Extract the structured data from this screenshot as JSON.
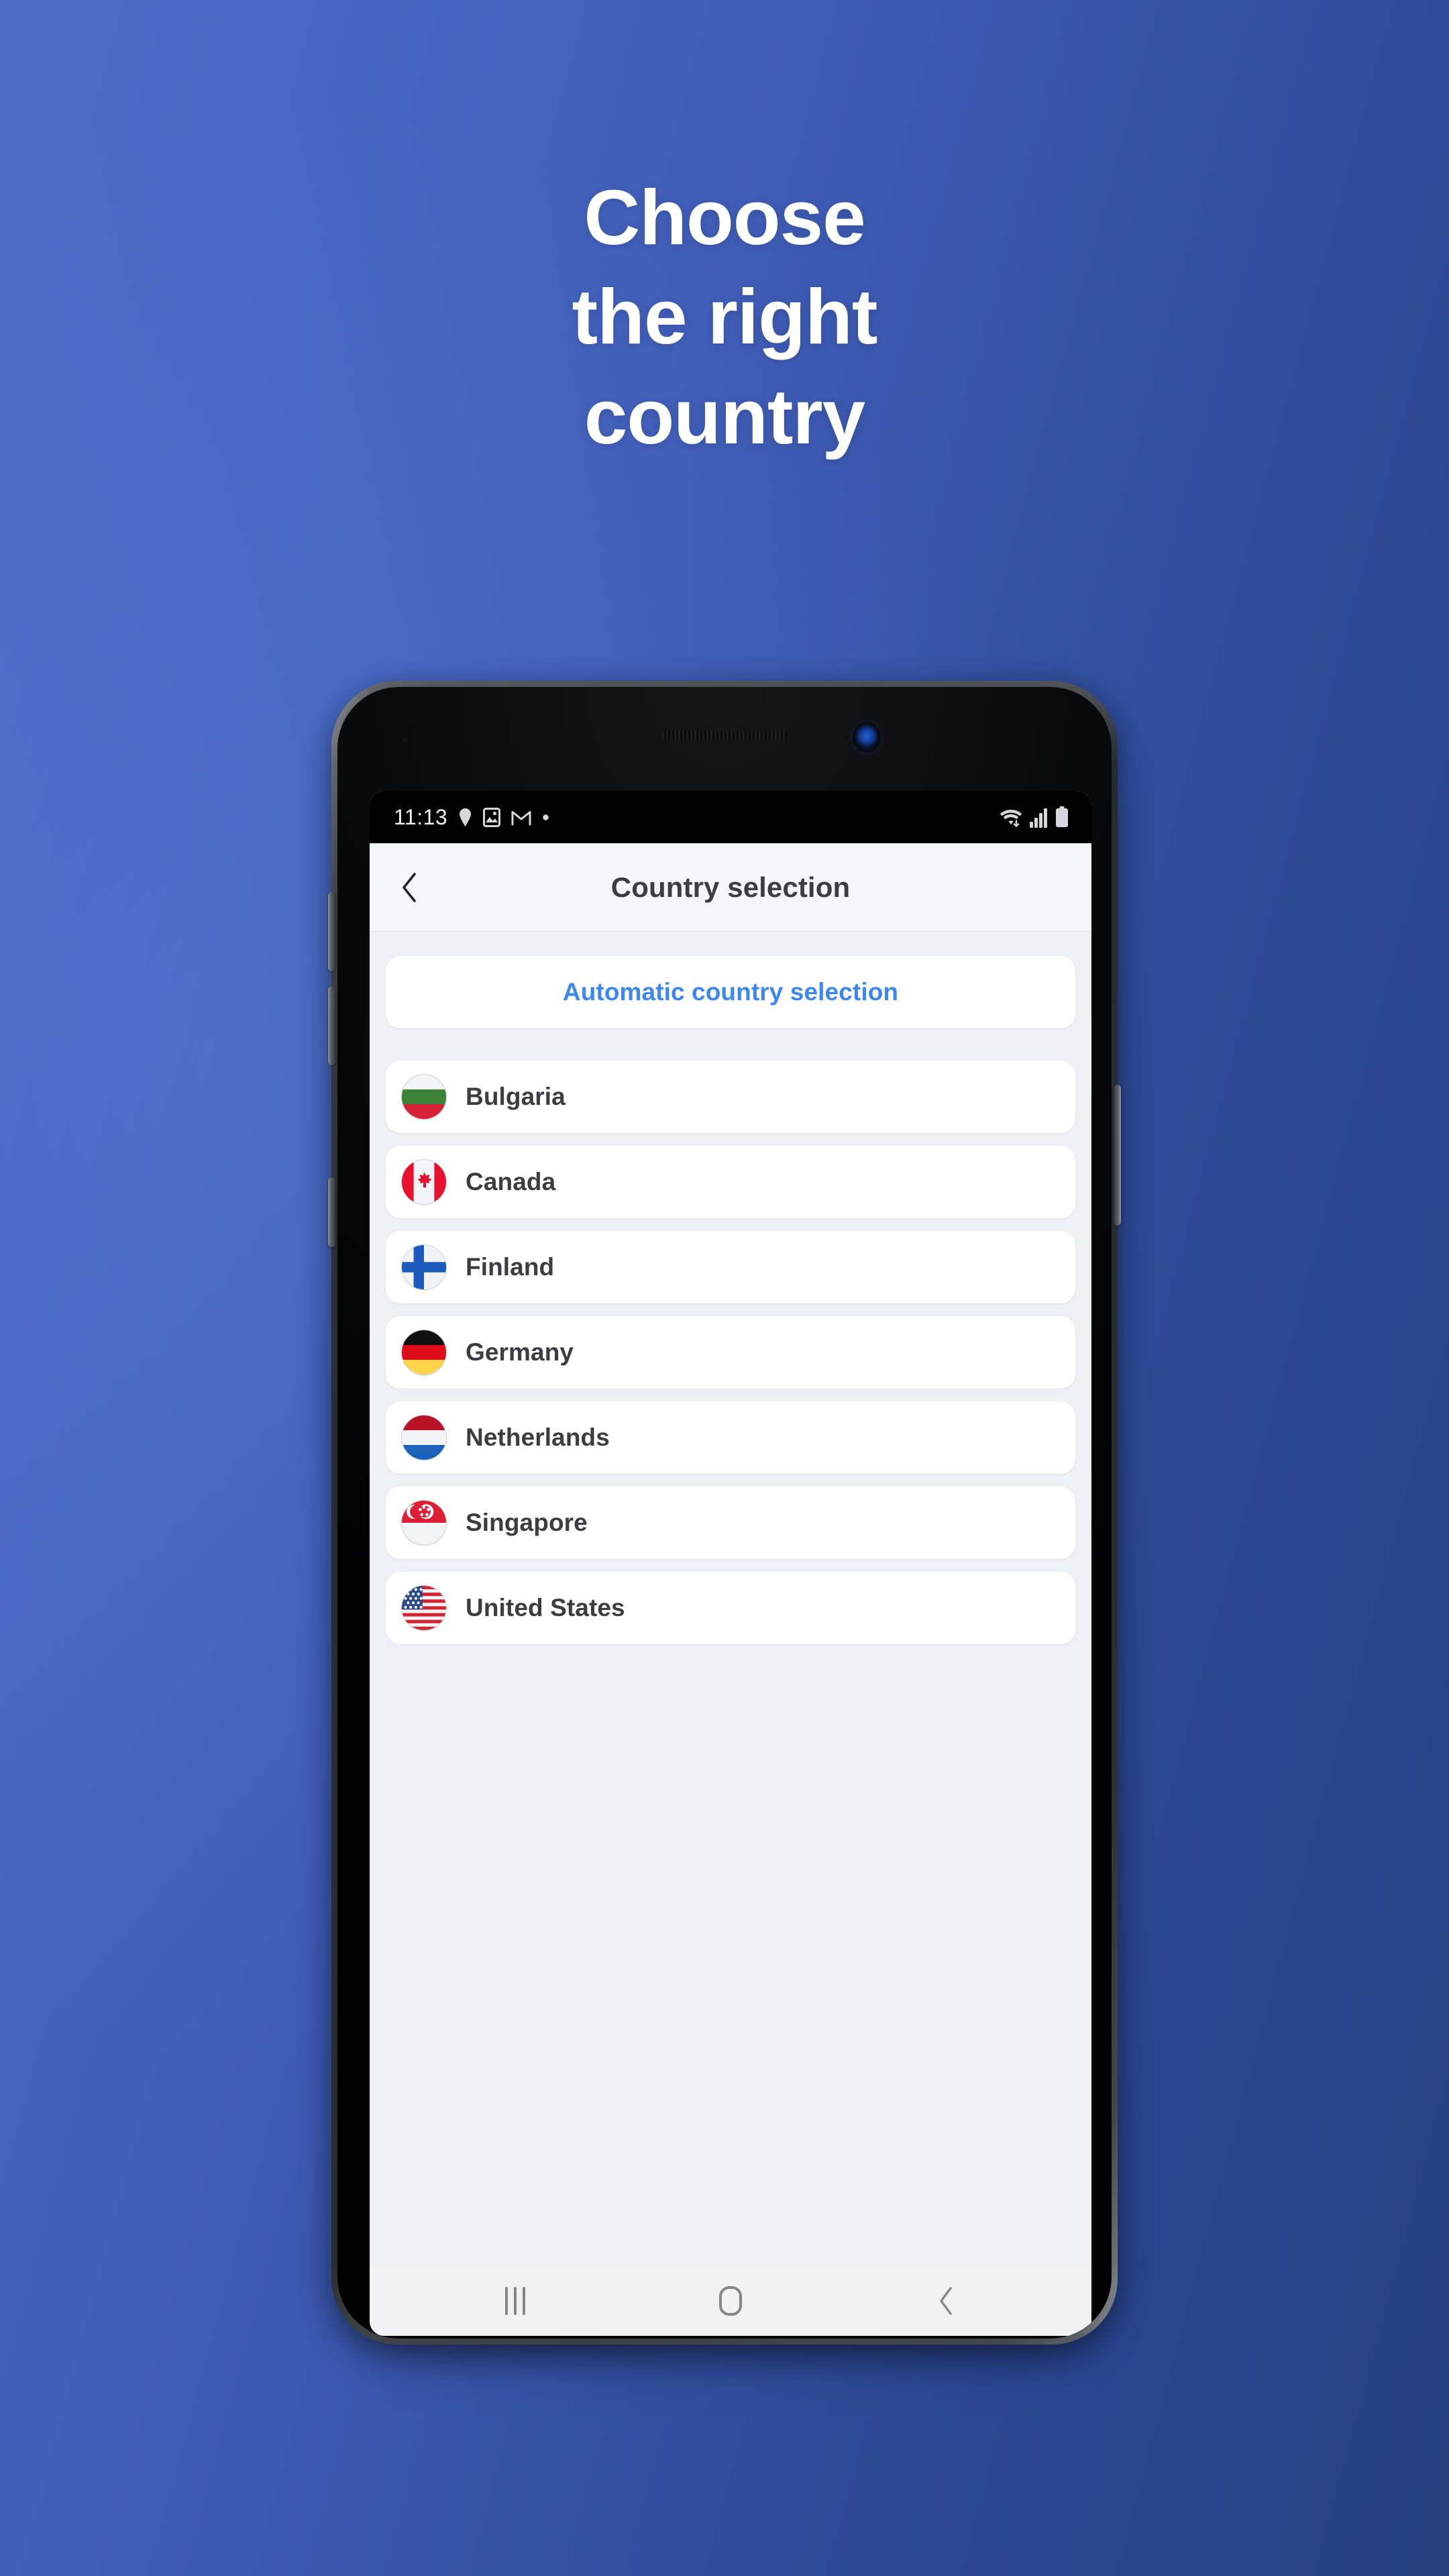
{
  "promo": {
    "headline_lines": [
      "Choose",
      "the right",
      "country"
    ],
    "background_color_left": "#4a6ec8",
    "background_color_right": "#26407f",
    "headline_color": "#ffffff"
  },
  "device": {
    "model_style": "Samsung Galaxy S-series",
    "side_buttons": [
      "volume-up",
      "volume-down",
      "bixby",
      "power"
    ]
  },
  "status_bar": {
    "time": "11:13",
    "left_icons": [
      "location-pin-icon",
      "image-icon",
      "gmail-icon",
      "dot-icon"
    ],
    "right_icons": [
      "wifi-icon",
      "cellular-signal-icon",
      "battery-icon"
    ],
    "background_color": "#000000"
  },
  "app_bar": {
    "back_icon": "chevron-left-icon",
    "title": "Country selection",
    "background_color": "#f5f6fb",
    "title_color": "#3b3d42"
  },
  "content": {
    "auto_select": {
      "label": "Automatic country selection",
      "accent_color": "#3d87f0"
    },
    "countries": [
      {
        "name": "Bulgaria",
        "flag": "bulgaria-flag-icon"
      },
      {
        "name": "Canada",
        "flag": "canada-flag-icon"
      },
      {
        "name": "Finland",
        "flag": "finland-flag-icon"
      },
      {
        "name": "Germany",
        "flag": "germany-flag-icon"
      },
      {
        "name": "Netherlands",
        "flag": "netherlands-flag-icon"
      },
      {
        "name": "Singapore",
        "flag": "singapore-flag-icon"
      },
      {
        "name": "United States",
        "flag": "united-states-flag-icon"
      }
    ],
    "background_color": "#eff0f5",
    "card_color": "#ffffff"
  },
  "nav_bar": {
    "buttons": [
      "recents-icon",
      "home-icon",
      "back-icon"
    ],
    "background_color": "#f2f2f5"
  }
}
